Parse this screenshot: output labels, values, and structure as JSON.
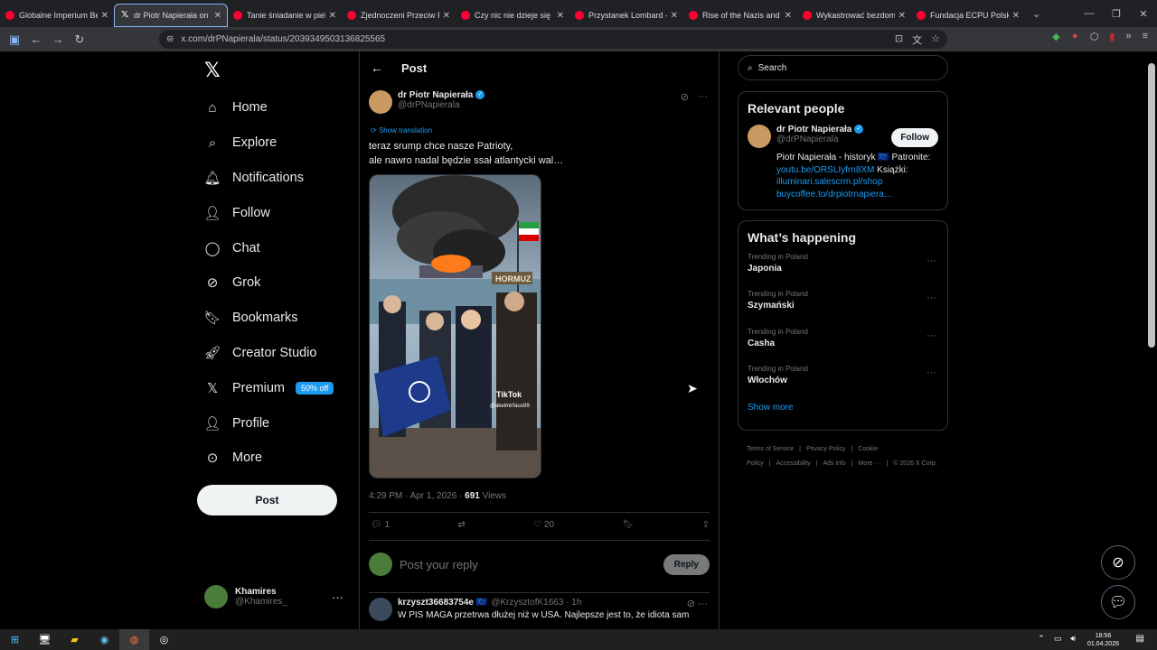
{
  "browser": {
    "tabs": [
      {
        "label": "Globalne Imperium Bezk",
        "fav": "youtube"
      },
      {
        "label": "dr Piotr Napierała on X",
        "fav": "x",
        "active": true
      },
      {
        "label": "Tanie śniadanie w piekarn",
        "fav": "youtube"
      },
      {
        "label": "Zjednoczeni Przeciw Rasi",
        "fav": "youtube"
      },
      {
        "label": "Czy nic nie dzieje się przy",
        "fav": "youtube"
      },
      {
        "label": "Przystanek Lombard - Od",
        "fav": "youtube"
      },
      {
        "label": "Rise of the Nazis and Ad",
        "fav": "youtube"
      },
      {
        "label": "Wykastrować bezdomno",
        "fav": "youtube"
      },
      {
        "label": "Fundacja ECPU Polska: ta",
        "fav": "youtube"
      }
    ],
    "url": "x.com/drPNapierala/status/2039349503136825565"
  },
  "nav": {
    "items": [
      {
        "label": "Home",
        "icon": "home-icon"
      },
      {
        "label": "Explore",
        "icon": "search-icon"
      },
      {
        "label": "Notifications",
        "icon": "bell-icon"
      },
      {
        "label": "Follow",
        "icon": "person-plus-icon"
      },
      {
        "label": "Chat",
        "icon": "chat-icon"
      },
      {
        "label": "Grok",
        "icon": "grok-icon"
      },
      {
        "label": "Bookmarks",
        "icon": "bookmark-icon"
      },
      {
        "label": "Creator Studio",
        "icon": "rocket-icon"
      },
      {
        "label": "Premium",
        "icon": "x-icon",
        "badge": "50% off"
      },
      {
        "label": "Profile",
        "icon": "person-icon"
      },
      {
        "label": "More",
        "icon": "more-icon"
      }
    ],
    "post_label": "Post"
  },
  "me": {
    "name": "Khamires",
    "handle": "@Khamires_"
  },
  "header": {
    "title": "Post"
  },
  "post": {
    "name": "dr Piotr Napierała",
    "handle": "@drPNapierala",
    "show_translation": "Show translation",
    "text_line1": "teraz srump chce nasze Patrioty,",
    "text_line2": "ale nawro nadal będzie ssał atlantycki wal…",
    "image_text_hormuz": "HORMUZ",
    "image_text_tiktok": "TikTok",
    "image_text_user": "@akelmirfauu99",
    "time": "4:29 PM · Apr 1, 2026 · ",
    "views": "691",
    "views_label": " Views",
    "replies": "1",
    "likes": "20",
    "reply_placeholder": "Post your reply",
    "reply_button": "Reply"
  },
  "comment": {
    "name": "krzyszt36683754e 🇪🇺",
    "handle": "@KrzysztofK1663 · 1h",
    "text": "W PIS MAGA przetrwa dłużej niż w USA. Najlepsze jest to, że idiota sam"
  },
  "right": {
    "search_placeholder": "Search",
    "relevant_title": "Relevant people",
    "person_name": "dr Piotr Napierała",
    "person_handle": "@drPNapierala",
    "follow_label": "Follow",
    "bio_text": "Piotr Napierała - historyk 🇪🇺 Patronite:",
    "bio_link1": "youtu.be/ORSLIyfrn8XM",
    "bio_text2": " Książki:",
    "bio_link2": "illuminari.salescrm.pl/shop",
    "bio_link3": "buycoffee.to/drpiotrnapiera…",
    "happening_title": "What’s happening",
    "trends": [
      {
        "context": "Trending in Poland",
        "title": "Japonia"
      },
      {
        "context": "Trending in Poland",
        "title": "Szymański"
      },
      {
        "context": "Trending in Poland",
        "title": "Casha"
      },
      {
        "context": "Trending in Poland",
        "title": "Włochów"
      }
    ],
    "show_more": "Show more",
    "footer": [
      "Terms of Service",
      "Privacy Policy",
      "Cookie Policy",
      "Accessibility",
      "Ads info",
      "More ···",
      "© 2026 X Corp."
    ]
  },
  "taskbar": {
    "time": "18:56",
    "date": "01.04.2026"
  },
  "colors": {
    "accent": "#1d9bf0",
    "background": "#000000",
    "border": "#2f3336"
  }
}
